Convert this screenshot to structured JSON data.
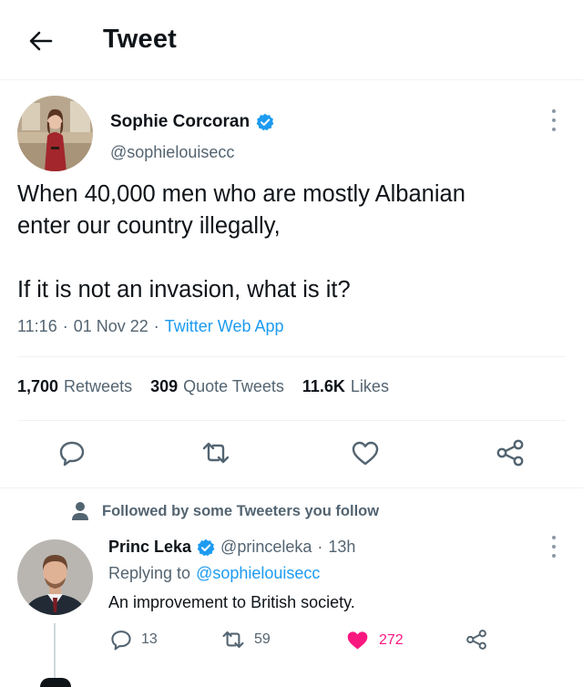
{
  "header": {
    "title": "Tweet",
    "back_icon": "arrow-left-icon"
  },
  "tweet": {
    "author": {
      "name": "Sophie Corcoran",
      "handle": "@sophielouisecc",
      "verified": true
    },
    "text_lines": [
      "When 40,000 men who are mostly Albanian",
      "enter our country illegally,",
      "If it is not an invasion, what is it?"
    ],
    "meta": {
      "time": "11:16",
      "date": "01 Nov 22",
      "separator": "·",
      "app": "Twitter Web App"
    },
    "stats": [
      {
        "count": "1,700",
        "label": "Retweets"
      },
      {
        "count": "309",
        "label": "Quote Tweets"
      },
      {
        "count": "11.6K",
        "label": "Likes"
      }
    ],
    "actions": [
      "reply-icon",
      "retweet-icon",
      "like-icon",
      "share-icon"
    ]
  },
  "reply": {
    "social_context": "Followed by some Tweeters you follow",
    "author": {
      "name": "Princ Leka",
      "handle": "@princeleka",
      "separator": "·",
      "time": "13h",
      "verified": true
    },
    "replying_to_label": "Replying to",
    "replying_to": "@sophielouisecc",
    "text": "An improvement to British society.",
    "counts": {
      "replies": "13",
      "retweets": "59",
      "likes": "272"
    },
    "liked": true
  },
  "colors": {
    "accent": "#1d9bf0",
    "like": "#f91880",
    "secondary_text": "#536471",
    "primary_text": "#0f1419"
  }
}
